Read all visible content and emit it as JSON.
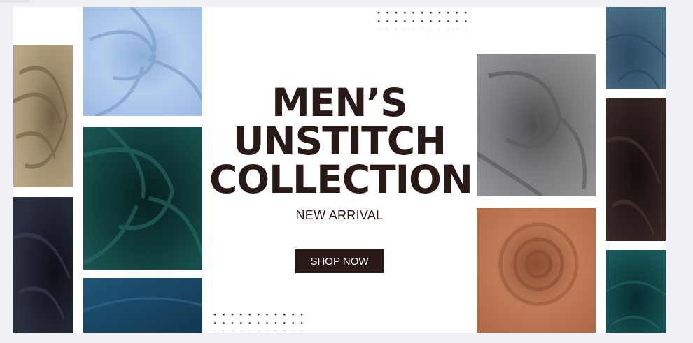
{
  "banner": {
    "headline_lines": [
      "MEN’S",
      "UNSTITCH",
      "COLLECTION"
    ],
    "subtitle": "NEW ARRIVAL",
    "cta_label": "SHOP NOW"
  },
  "colors": {
    "headline": "#2a1a17",
    "button_bg": "#2a1a17",
    "button_text": "#ffffff",
    "page_bg": "#eef0f5"
  },
  "fabric_tiles": [
    {
      "name": "khaki-fabric",
      "color": "#a18e6e"
    },
    {
      "name": "black-fabric",
      "color": "#1c1f2b"
    },
    {
      "name": "light-blue-fabric",
      "color": "#a5c3e8"
    },
    {
      "name": "dark-teal-fabric",
      "color": "#0f3c3a"
    },
    {
      "name": "petrol-blue-fabric",
      "color": "#1d4a6b"
    },
    {
      "name": "grey-fabric",
      "color": "#7c7a7d"
    },
    {
      "name": "terracotta-fabric",
      "color": "#b8714f"
    },
    {
      "name": "steel-blue-fabric",
      "color": "#3d5f78"
    },
    {
      "name": "dark-brown-fabric",
      "color": "#2b1e1c"
    },
    {
      "name": "deep-teal-fabric",
      "color": "#0d4447"
    }
  ]
}
